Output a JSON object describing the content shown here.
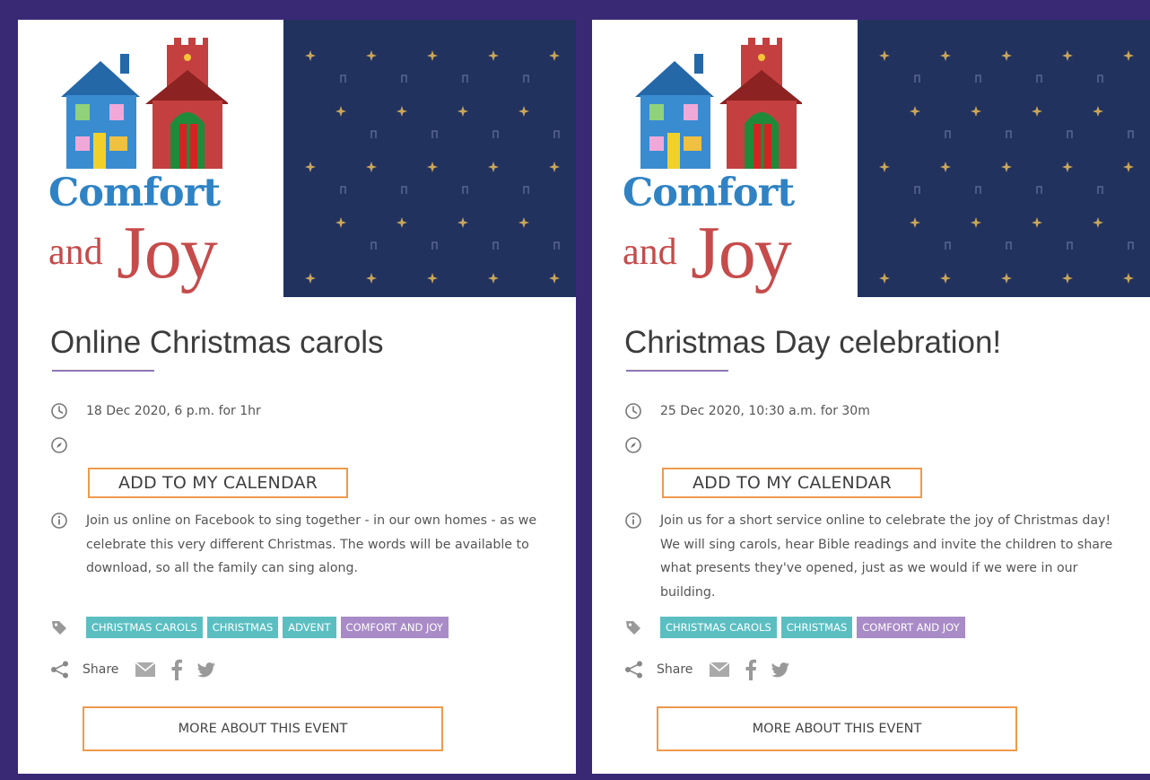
{
  "colors": {
    "page_background": "#392975",
    "card_background": "#ffffff",
    "pattern_background": "#22325f",
    "button_border": "#ee9a4c",
    "tag_teal": "#5bbfc2",
    "tag_purple": "#a98bc7",
    "logo_blue": "#2f83c4",
    "logo_red": "#c64b4b"
  },
  "logo": {
    "line1": "Comfort",
    "line2a": "and",
    "line2b": "Joy"
  },
  "events": [
    {
      "title": "Online Christmas carols",
      "when": "18 Dec 2020, 6 p.m. for 1hr",
      "calendar_button": "ADD TO MY CALENDAR",
      "description": "Join us online on Facebook to sing together - in our own homes - as we celebrate this very different Christmas. The words will be available to download, so all the family can sing along.",
      "tags": [
        {
          "label": "CHRISTMAS CAROLS",
          "color": "#5bbfc2"
        },
        {
          "label": "CHRISTMAS",
          "color": "#5bbfc2"
        },
        {
          "label": "ADVENT",
          "color": "#5bbfc2"
        },
        {
          "label": "COMFORT AND JOY",
          "color": "#a98bc7"
        }
      ],
      "share_label": "Share",
      "share_icons": [
        "email-icon",
        "facebook-icon",
        "twitter-icon"
      ],
      "more_button": "MORE ABOUT THIS EVENT"
    },
    {
      "title": "Christmas Day celebration!",
      "when": "25 Dec 2020, 10:30 a.m. for 30m",
      "calendar_button": "ADD TO MY CALENDAR",
      "description": "Join us for a short service online to celebrate the joy of Christmas day! We will sing carols, hear Bible readings and invite the children to share what presents they've opened, just as we would if we were in our building.",
      "tags": [
        {
          "label": "CHRISTMAS CAROLS",
          "color": "#5bbfc2"
        },
        {
          "label": "CHRISTMAS",
          "color": "#5bbfc2"
        },
        {
          "label": "COMFORT AND JOY",
          "color": "#a98bc7"
        }
      ],
      "share_label": "Share",
      "share_icons": [
        "email-icon",
        "facebook-icon",
        "twitter-icon"
      ],
      "more_button": "MORE ABOUT THIS EVENT"
    }
  ]
}
